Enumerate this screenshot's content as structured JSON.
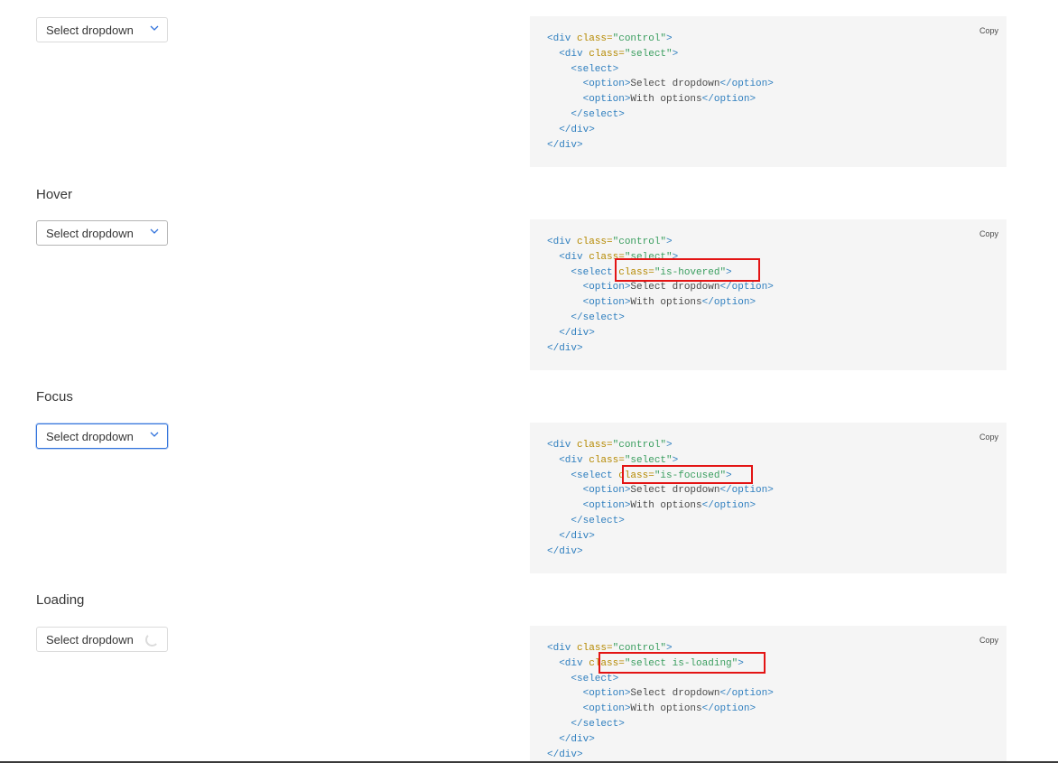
{
  "select_label": "Select dropdown",
  "copy_label": "Copy",
  "headings": {
    "hover": "Hover",
    "focus": "Focus",
    "loading": "Loading"
  },
  "code": {
    "line1_open": "<div ",
    "line1_attr": "class=",
    "line1_val": "\"control\"",
    "line1_close": ">",
    "line2_open": "<div ",
    "line2_attr": "class=",
    "line2_val": "\"select\"",
    "line2_close": ">",
    "select_open": "<select>",
    "select_open_tag": "<select ",
    "opt1_open": "<option>",
    "opt1_text": "Select dropdown",
    "opt1_close": "</option>",
    "opt2_open": "<option>",
    "opt2_text": "With options",
    "opt2_close": "</option>",
    "select_close": "</select>",
    "div_close": "</div>",
    "hovered_attr": "class=",
    "hovered_val": "\"is-hovered\"",
    "focused_attr": "class=",
    "focused_val": "\"is-focused\"",
    "loading_val": "\"select is-loading\""
  },
  "colors": {
    "tag": "#2f7fbf",
    "attr": "#b58900",
    "string": "#3a9e5f",
    "highlight": "#e31414",
    "focus": "#3273dc"
  }
}
